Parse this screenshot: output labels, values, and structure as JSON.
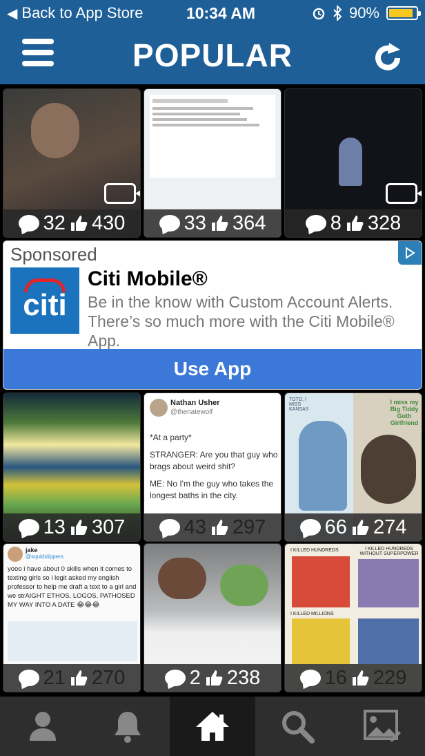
{
  "status": {
    "back_label": "Back to App Store",
    "time": "10:34 AM",
    "battery_pct": "90%"
  },
  "nav": {
    "title": "POPULAR"
  },
  "rows": [
    [
      {
        "comments": "32",
        "likes": "430",
        "video": true,
        "bg": "#4a3c35"
      },
      {
        "comments": "33",
        "likes": "364",
        "video": false,
        "bg": "#e8ecef"
      },
      {
        "comments": "8",
        "likes": "328",
        "video": true,
        "bg": "#15161c"
      }
    ],
    [
      {
        "comments": "13",
        "likes": "307",
        "video": false,
        "bg": "#3d5a55"
      },
      {
        "comments": "43",
        "likes": "297",
        "video": false,
        "bg": "#ffffff"
      },
      {
        "comments": "66",
        "likes": "274",
        "video": false,
        "bg": "#cfc7b8"
      }
    ],
    [
      {
        "comments": "21",
        "likes": "270",
        "video": false,
        "bg": "#f4f4f4"
      },
      {
        "comments": "2",
        "likes": "238",
        "video": false,
        "bg": "#8a8c8e"
      },
      {
        "comments": "16",
        "likes": "229",
        "video": false,
        "bg": "#e7e2d6"
      }
    ]
  ],
  "ad": {
    "sponsored_label": "Sponsored",
    "logo_text": "citi",
    "name": "Citi Mobile®",
    "description": "Be in the know with Custom Account Alerts. There’s so much more with the Citi Mobile® App.",
    "cta": "Use App"
  },
  "tiles_text": {
    "tweet_user": "Nathan Usher",
    "tweet_handle": "@thenatewolf",
    "tweet_lines": [
      "*At a party*",
      "STRANGER: Are you that guy who brags about weird shit?",
      "ME: No I'm the guy who takes the longest baths in the city."
    ],
    "jake_name": "jake",
    "jake_handle": "@squidslippers",
    "jake_text": "yooo i have about 0 skills when it comes to texting girls so i legit asked my english professor to help me draft a text to a girl and we strAIGHT ETHOS, LOGOS, PATHOSED MY WAY INTO A DATE 😂😂😂",
    "comic_caption": "I miss my Big Tiddy Goth Girlfriend",
    "comic_tag": "TOTO, I MISS KANSAS",
    "meme_top_left": "I KILLED HUNDREDS",
    "meme_top_right": "I KILLED HUNDREDS WITHOUT SUPERPOWER",
    "meme_mid": "I KILLED MILLIONS"
  },
  "tabs": [
    "profile",
    "notifications",
    "home",
    "search",
    "upload"
  ],
  "colors": {
    "nav_blue": "#1d5f96",
    "cta_blue": "#3c78d8",
    "battery": "#f6c81f"
  }
}
